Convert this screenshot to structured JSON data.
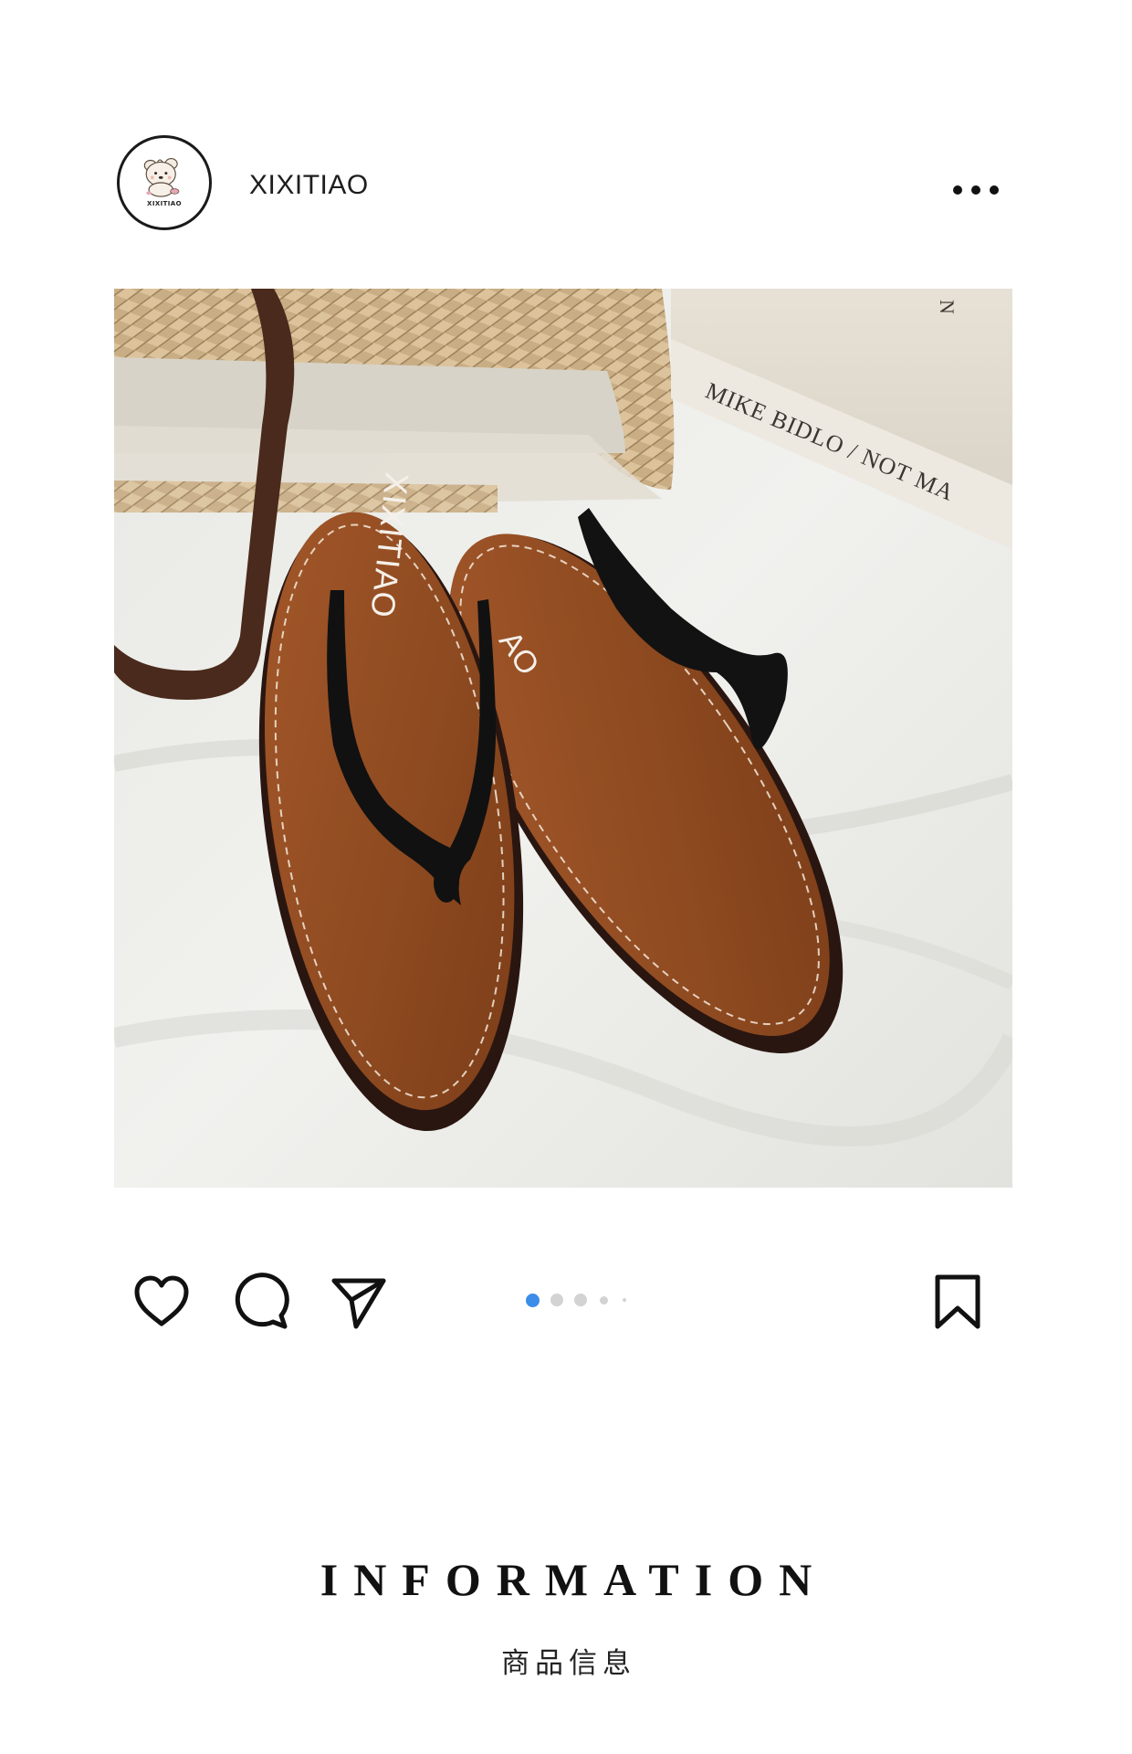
{
  "post": {
    "account": {
      "username": "XIXITIAO",
      "avatar_caption": "XIXITIAO",
      "avatar_icon": "bear-mascot-logo"
    },
    "more_icon": "more-horizontal-icon",
    "image": {
      "product": "brown leather flip-flop sandals",
      "insole_brand_text": "XIXITIAO",
      "second_insole_text": "AO",
      "book_text": "MIKE BIDLO / NOT MA",
      "book_spine_letter": "N"
    },
    "actions": {
      "like_icon": "heart-icon",
      "comment_icon": "comment-bubble-icon",
      "share_icon": "send-paper-plane-icon",
      "save_icon": "bookmark-icon"
    },
    "carousel": {
      "total_dots": 5,
      "active_index": 1,
      "active_color": "#3d8ce8",
      "inactive_color": "#d3d3d3"
    }
  },
  "info": {
    "title": "INFORMATION",
    "subtitle": "商品信息"
  }
}
